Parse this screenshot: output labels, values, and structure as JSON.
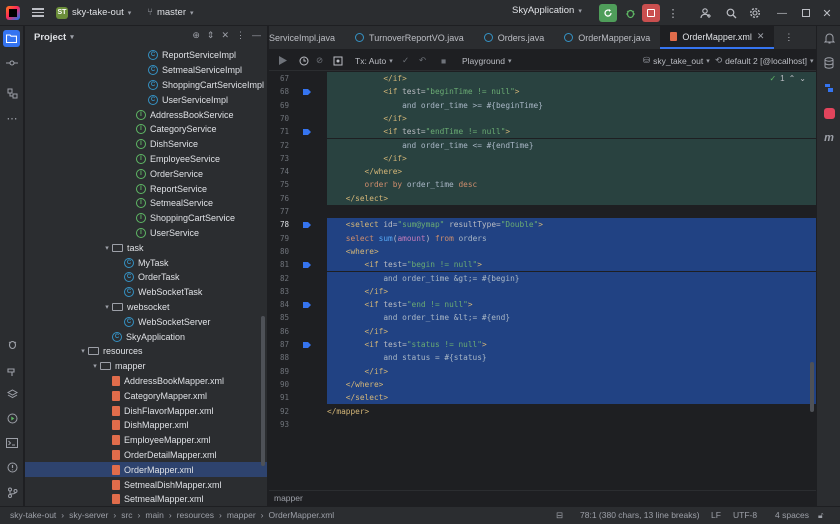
{
  "titlebar": {
    "project_badge": "ST",
    "project_name": "sky-take-out",
    "branch": "master",
    "run_config": "SkyApplication"
  },
  "project_panel": {
    "title": "Project",
    "tree": [
      {
        "label": "ReportServiceImpl",
        "icon": "class",
        "depth": 9
      },
      {
        "label": "SetmealServiceImpl",
        "icon": "class",
        "depth": 9
      },
      {
        "label": "ShoppingCartServiceImpl",
        "icon": "class",
        "depth": 9
      },
      {
        "label": "UserServiceImpl",
        "icon": "class",
        "depth": 9
      },
      {
        "label": "AddressBookService",
        "icon": "interface",
        "depth": 8
      },
      {
        "label": "CategoryService",
        "icon": "interface",
        "depth": 8
      },
      {
        "label": "DishService",
        "icon": "interface",
        "depth": 8
      },
      {
        "label": "EmployeeService",
        "icon": "interface",
        "depth": 8
      },
      {
        "label": "OrderService",
        "icon": "interface",
        "depth": 8
      },
      {
        "label": "ReportService",
        "icon": "interface",
        "depth": 8
      },
      {
        "label": "SetmealService",
        "icon": "interface",
        "depth": 8
      },
      {
        "label": "ShoppingCartService",
        "icon": "interface",
        "depth": 8
      },
      {
        "label": "UserService",
        "icon": "interface",
        "depth": 8
      },
      {
        "label": "task",
        "icon": "folder",
        "depth": 6,
        "arrow": "▾"
      },
      {
        "label": "MyTask",
        "icon": "class",
        "depth": 7
      },
      {
        "label": "OrderTask",
        "icon": "class",
        "depth": 7
      },
      {
        "label": "WebSocketTask",
        "icon": "class",
        "depth": 7
      },
      {
        "label": "websocket",
        "icon": "folder",
        "depth": 6,
        "arrow": "▾"
      },
      {
        "label": "WebSocketServer",
        "icon": "class",
        "depth": 7
      },
      {
        "label": "SkyApplication",
        "icon": "app",
        "depth": 6
      },
      {
        "label": "resources",
        "icon": "folder",
        "depth": 4,
        "arrow": "▾"
      },
      {
        "label": "mapper",
        "icon": "folder",
        "depth": 5,
        "arrow": "▾"
      },
      {
        "label": "AddressBookMapper.xml",
        "icon": "xml",
        "depth": 6
      },
      {
        "label": "CategoryMapper.xml",
        "icon": "xml",
        "depth": 6
      },
      {
        "label": "DishFlavorMapper.xml",
        "icon": "xml",
        "depth": 6
      },
      {
        "label": "DishMapper.xml",
        "icon": "xml",
        "depth": 6
      },
      {
        "label": "EmployeeMapper.xml",
        "icon": "xml",
        "depth": 6
      },
      {
        "label": "OrderDetailMapper.xml",
        "icon": "xml",
        "depth": 6
      },
      {
        "label": "OrderMapper.xml",
        "icon": "xml",
        "depth": 6,
        "selected": true
      },
      {
        "label": "SetmealDishMapper.xml",
        "icon": "xml",
        "depth": 6
      },
      {
        "label": "SetmealMapper.xml",
        "icon": "xml",
        "depth": 6
      }
    ]
  },
  "tabs": [
    {
      "label": "ServiceImpl.java",
      "icon": "java"
    },
    {
      "label": "TurnoverReportVO.java",
      "icon": "java"
    },
    {
      "label": "Orders.java",
      "icon": "java"
    },
    {
      "label": "OrderMapper.java",
      "icon": "java"
    },
    {
      "label": "OrderMapper.xml",
      "icon": "xml",
      "active": true
    }
  ],
  "editor_toolbar": {
    "tx": "Tx: Auto",
    "playground": "Playground",
    "schema": "sky_take_out",
    "datasource": "default 2 [@localhost]"
  },
  "inspection": {
    "count": "1"
  },
  "code": [
    {
      "n": "67",
      "bg": "green",
      "parts": [
        [
          "t-tag",
          "            </if>"
        ]
      ]
    },
    {
      "n": "68",
      "bg": "green",
      "parts": [
        [
          "t-tag",
          "            <if "
        ],
        [
          "t-attr",
          "test="
        ],
        [
          "t-str",
          "\"beginTime != null\""
        ],
        [
          "t-tag",
          ">"
        ]
      ]
    },
    {
      "n": "69",
      "bg": "green",
      "parts": [
        [
          "t-txt",
          "                and order_time >= #{beginTime}"
        ]
      ]
    },
    {
      "n": "70",
      "bg": "green",
      "parts": [
        [
          "t-tag",
          "            </if>"
        ]
      ]
    },
    {
      "n": "71",
      "bg": "green",
      "parts": [
        [
          "t-tag",
          "            <if "
        ],
        [
          "t-attr",
          "test="
        ],
        [
          "t-str",
          "\"endTime != null\""
        ],
        [
          "t-tag",
          ">"
        ]
      ]
    },
    {
      "n": "72",
      "bg": "green",
      "parts": [
        [
          "t-txt",
          "                and order_time <= #{endTime}"
        ]
      ]
    },
    {
      "n": "73",
      "bg": "green",
      "parts": [
        [
          "t-tag",
          "            </if>"
        ]
      ]
    },
    {
      "n": "74",
      "bg": "green",
      "parts": [
        [
          "t-tag",
          "        </where>"
        ]
      ]
    },
    {
      "n": "75",
      "bg": "green",
      "parts": [
        [
          "t-kw",
          "        order by "
        ],
        [
          "t-txt",
          "order_time "
        ],
        [
          "t-kw",
          "desc"
        ]
      ]
    },
    {
      "n": "76",
      "bg": "green",
      "parts": [
        [
          "t-tag",
          "    </select>"
        ]
      ]
    },
    {
      "n": "77",
      "bg": "",
      "parts": []
    },
    {
      "n": "78",
      "bg": "sel",
      "cur": true,
      "parts": [
        [
          "t-tag",
          "    <select "
        ],
        [
          "t-attr",
          "id="
        ],
        [
          "t-str",
          "\"sum@ymap\" "
        ],
        [
          "t-attr",
          "resultType="
        ],
        [
          "t-str",
          "\"Double\""
        ],
        [
          "t-tag",
          ">"
        ]
      ]
    },
    {
      "n": "79",
      "bg": "sel",
      "parts": [
        [
          "t-kw",
          "    select "
        ],
        [
          "t-fn",
          "sum"
        ],
        [
          "t-plain",
          "("
        ],
        [
          "t-hl",
          "amount"
        ],
        [
          "t-plain",
          ") "
        ],
        [
          "t-kw",
          "from "
        ],
        [
          "t-txt",
          "orders"
        ]
      ]
    },
    {
      "n": "80",
      "bg": "sel",
      "parts": [
        [
          "t-tag",
          "    <where>"
        ]
      ]
    },
    {
      "n": "81",
      "bg": "sel",
      "parts": [
        [
          "t-tag",
          "        <if "
        ],
        [
          "t-attr",
          "test="
        ],
        [
          "t-str",
          "\"begin != null\""
        ],
        [
          "t-tag",
          ">"
        ]
      ]
    },
    {
      "n": "82",
      "bg": "sel",
      "parts": [
        [
          "t-txt",
          "            and order_time &gt;= #{begin}"
        ]
      ]
    },
    {
      "n": "83",
      "bg": "sel",
      "parts": [
        [
          "t-tag",
          "        </if>"
        ]
      ]
    },
    {
      "n": "84",
      "bg": "sel",
      "parts": [
        [
          "t-tag",
          "        <if "
        ],
        [
          "t-attr",
          "test="
        ],
        [
          "t-str",
          "\"end != null\""
        ],
        [
          "t-tag",
          ">"
        ]
      ]
    },
    {
      "n": "85",
      "bg": "sel",
      "parts": [
        [
          "t-txt",
          "            and order_time &lt;= #{end}"
        ]
      ]
    },
    {
      "n": "86",
      "bg": "sel",
      "parts": [
        [
          "t-tag",
          "        </if>"
        ]
      ]
    },
    {
      "n": "87",
      "bg": "sel",
      "parts": [
        [
          "t-tag",
          "        <if "
        ],
        [
          "t-attr",
          "test="
        ],
        [
          "t-str",
          "\"status != null\""
        ],
        [
          "t-tag",
          ">"
        ]
      ]
    },
    {
      "n": "88",
      "bg": "sel",
      "parts": [
        [
          "t-txt",
          "            and status = #{status}"
        ]
      ]
    },
    {
      "n": "89",
      "bg": "sel",
      "parts": [
        [
          "t-tag",
          "        </if>"
        ]
      ]
    },
    {
      "n": "90",
      "bg": "sel",
      "parts": [
        [
          "t-tag",
          "    </where>"
        ]
      ]
    },
    {
      "n": "91",
      "bg": "sel",
      "parts": [
        [
          "t-tag",
          "    </select>"
        ]
      ]
    },
    {
      "n": "92",
      "bg": "",
      "parts": [
        [
          "t-tag",
          "</mapper>"
        ]
      ]
    },
    {
      "n": "93",
      "bg": "",
      "parts": []
    }
  ],
  "gutter_markers": [
    "68",
    "71",
    "78",
    "81",
    "84",
    "87"
  ],
  "breadcrumb": "mapper",
  "statusbar": {
    "path": [
      "sky-take-out",
      "sky-server",
      "src",
      "main",
      "resources",
      "mapper",
      "OrderMapper.xml"
    ],
    "position": "78:1 (380 chars, 13 line breaks)",
    "line_sep": "LF",
    "encoding": "UTF-8",
    "indent": "4 spaces"
  },
  "colors": {
    "accent": "#3574f0",
    "selection": "#214283",
    "green_bg": "#294240"
  }
}
